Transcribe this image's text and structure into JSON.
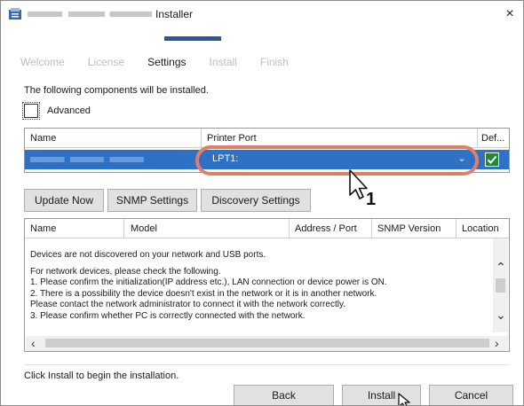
{
  "window": {
    "title": "Installer",
    "close_glyph": "×"
  },
  "steps": [
    {
      "label": "Welcome",
      "active": false
    },
    {
      "label": "License",
      "active": false
    },
    {
      "label": "Settings",
      "active": true
    },
    {
      "label": "Install",
      "active": false
    },
    {
      "label": "Finish",
      "active": false
    }
  ],
  "intro_text": "The following components will be installed.",
  "advanced": {
    "label": "Advanced",
    "checked": false
  },
  "components_table": {
    "headers": {
      "name": "Name",
      "printer_port": "Printer Port",
      "default": "Def..."
    },
    "rows": [
      {
        "name": "",
        "printer_port": "LPT1:",
        "default_checked": true,
        "selected": true
      }
    ]
  },
  "buttons": {
    "update_now": "Update Now",
    "snmp_settings": "SNMP Settings",
    "discovery_settings": "Discovery Settings"
  },
  "annotation": {
    "step_number": "1"
  },
  "devices_table": {
    "headers": {
      "name": "Name",
      "model": "Model",
      "address_port": "Address / Port",
      "snmp_version": "SNMP Version",
      "location": "Location"
    },
    "message_lines": [
      "Devices are not discovered on your network and USB ports.",
      "For network devices, please check the following.",
      "1. Please confirm the initialization(IP address etc.), LAN connection or device power is ON.",
      "2. There is a possibility the device doesn't exist in the network or it is in another network.",
      "Please contact the network administrator to connect it with the network correctly.",
      "3. Please confirm whether PC is correctly connected with the network."
    ]
  },
  "footer_text": "Click Install to begin the installation.",
  "nav": {
    "back": "Back",
    "install": "Install",
    "cancel": "Cancel"
  },
  "colors": {
    "accent": "#2f5597",
    "selection": "#2f71c4",
    "callout": "#e0806a",
    "check": "#1f8a33"
  }
}
